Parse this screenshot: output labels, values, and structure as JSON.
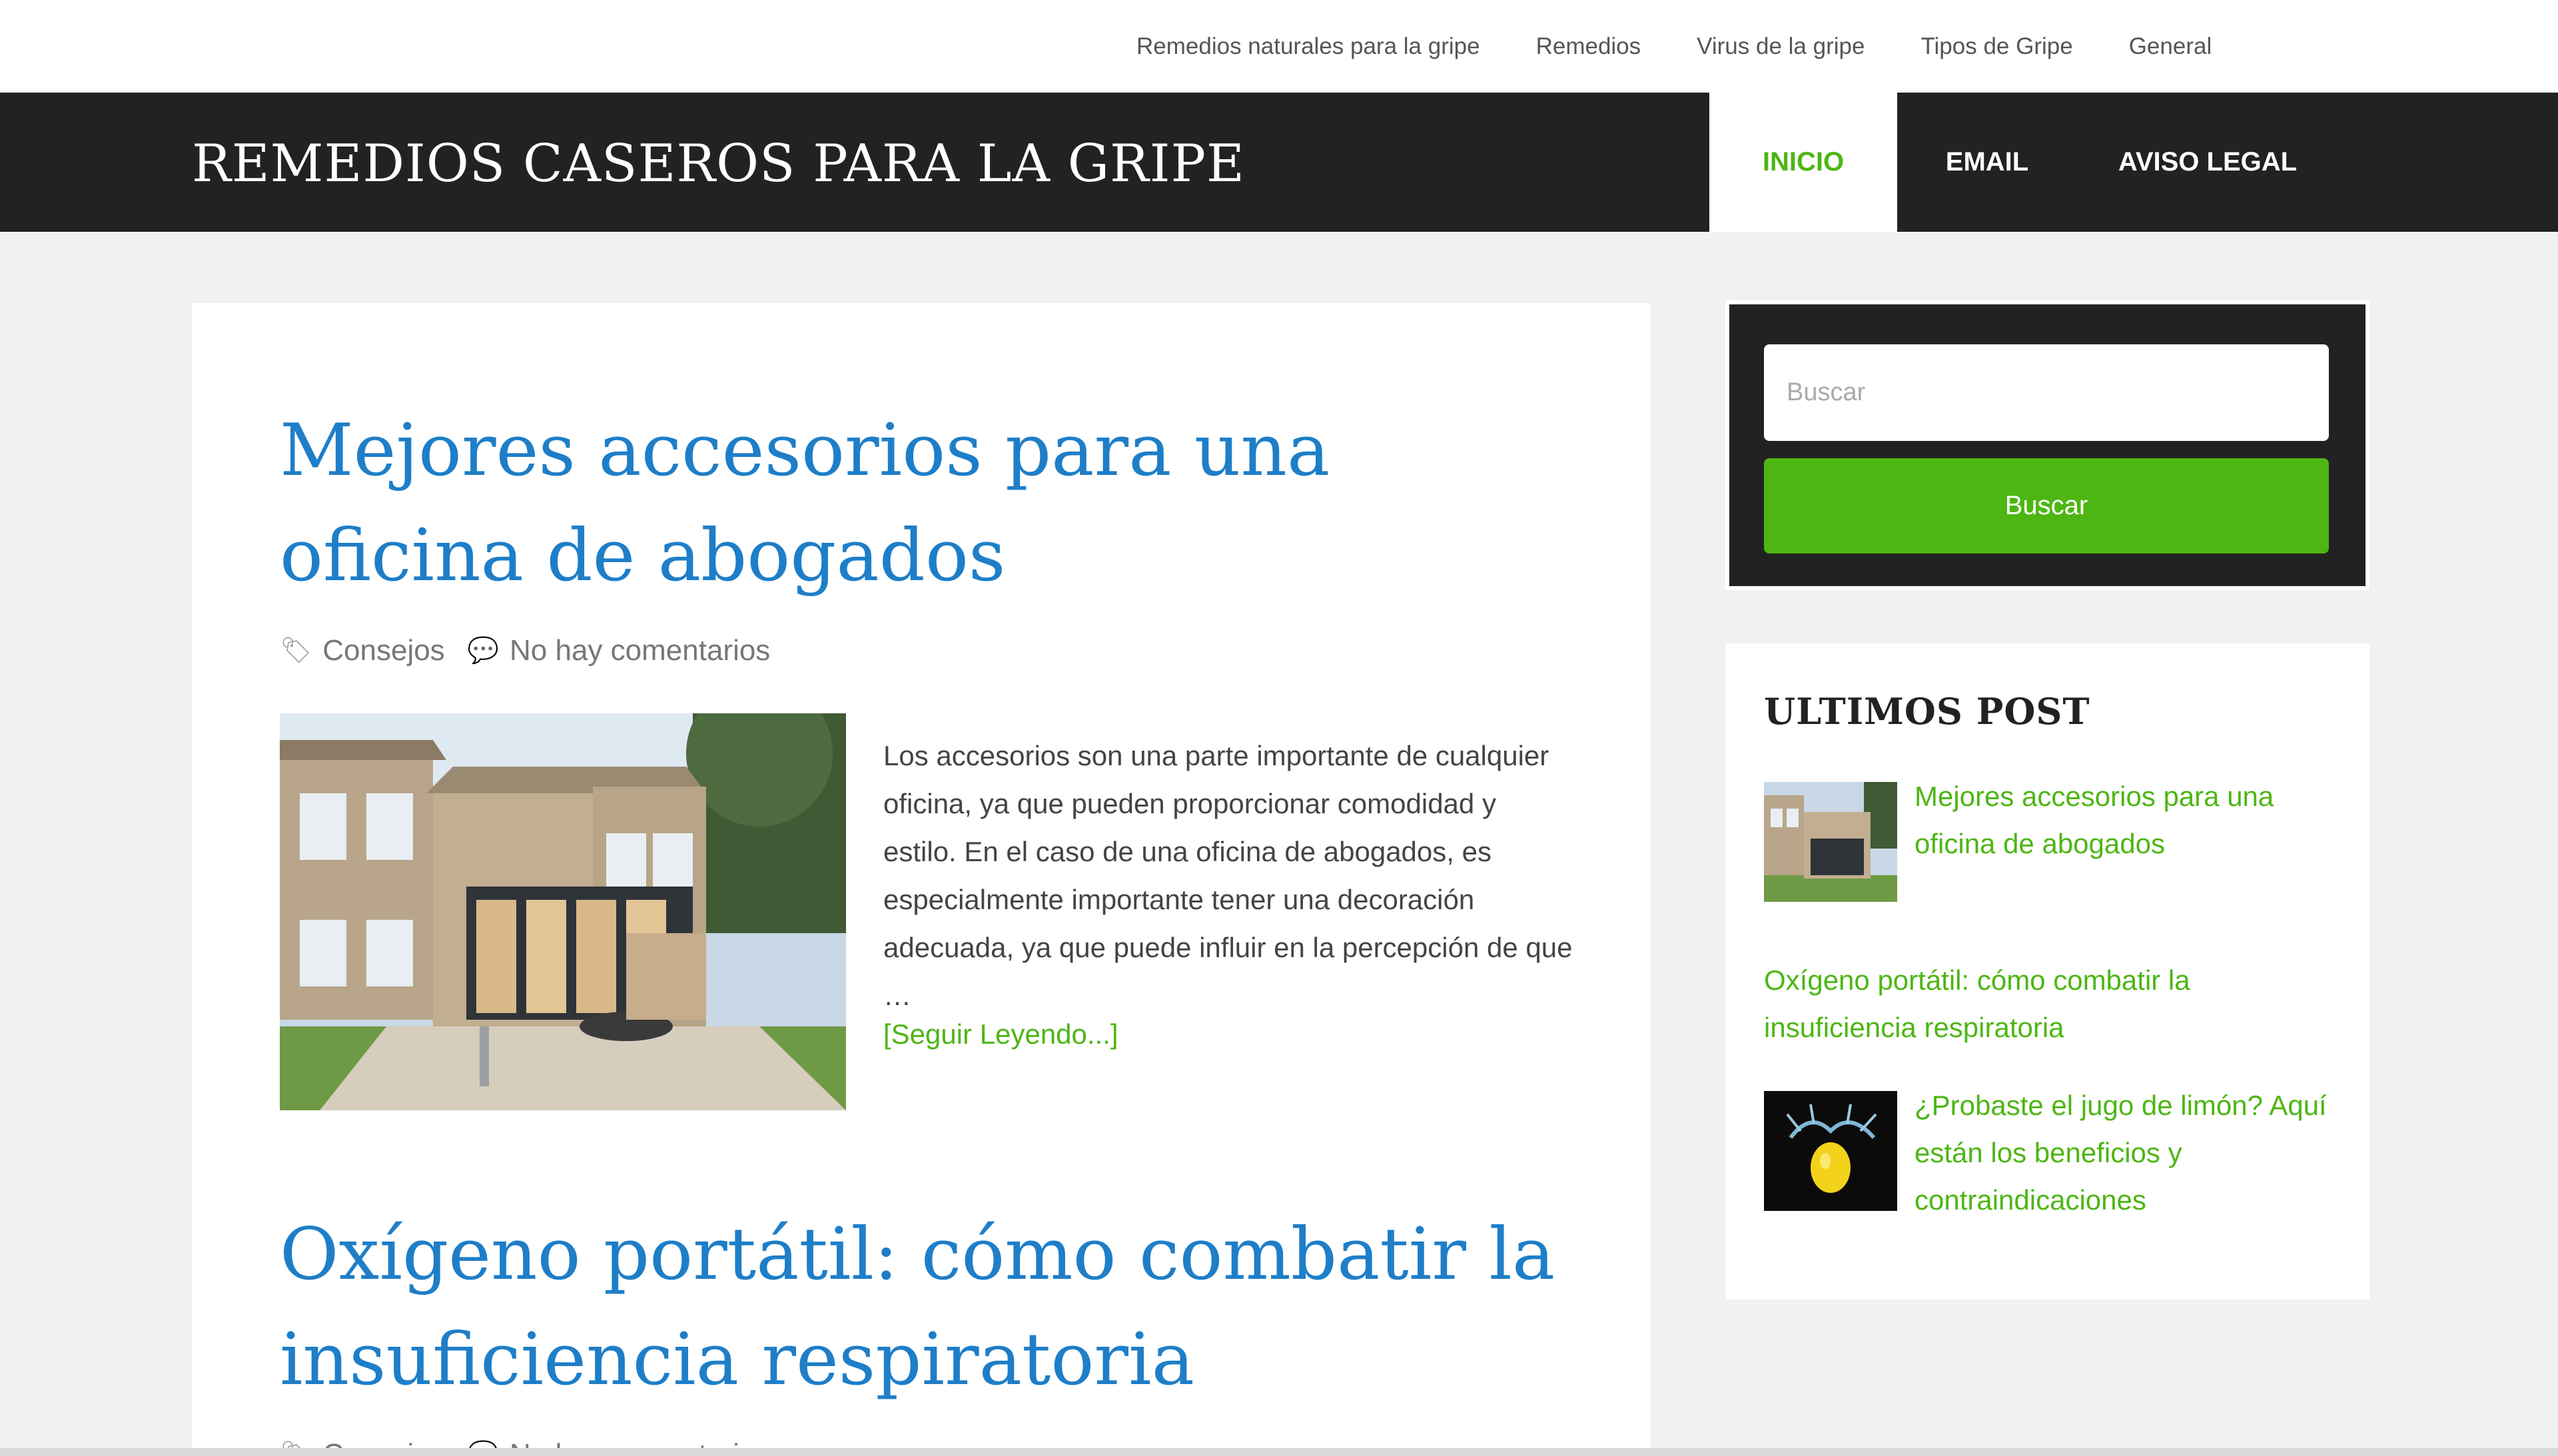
{
  "top_nav": {
    "items": [
      {
        "label": "Remedios naturales para la gripe"
      },
      {
        "label": "Remedios"
      },
      {
        "label": "Virus de la gripe"
      },
      {
        "label": "Tipos de Gripe"
      },
      {
        "label": "General"
      }
    ]
  },
  "header": {
    "site_title": "REMEDIOS CASEROS PARA LA GRIPE",
    "nav": {
      "inicio": "INICIO",
      "email": "EMAIL",
      "aviso_legal": "AVISO LEGAL"
    }
  },
  "posts": [
    {
      "title": "Mejores accesorios para una oficina de abogados",
      "category": "Consejos",
      "comments": "No hay comentarios",
      "excerpt": "Los accesorios son una parte importante de cualquier oficina, ya que pueden proporcionar comodidad y estilo. En el caso de una oficina de abogados, es especialmente importante tener una decoración adecuada, ya que puede influir en la percepción de que …",
      "read_more": "[Seguir Leyendo...]",
      "thumbnail_icon": "house-photo-icon"
    },
    {
      "title": "Oxígeno portátil: cómo combatir la insuficiencia respiratoria",
      "category": "Consejos",
      "comments": "No hay comentarios"
    }
  ],
  "sidebar": {
    "search": {
      "placeholder": "Buscar",
      "button_label": "Buscar"
    },
    "recent": {
      "title": "ULTIMOS POST",
      "items": [
        {
          "label": "Mejores accesorios para una oficina de abogados",
          "thumbnail_icon": "house-photo-icon"
        },
        {
          "label": "Oxígeno portátil: cómo combatir la insuficiencia respiratoria"
        },
        {
          "label": "¿Probaste el jugo de limón? Aquí están los beneficios y contraindicaciones",
          "thumbnail_icon": "lemon-splash-icon"
        }
      ]
    }
  },
  "colors": {
    "accent_green": "#4db613",
    "link_blue": "#1e7ec8",
    "header_dark": "#222222",
    "background": "#f1f1f1"
  }
}
